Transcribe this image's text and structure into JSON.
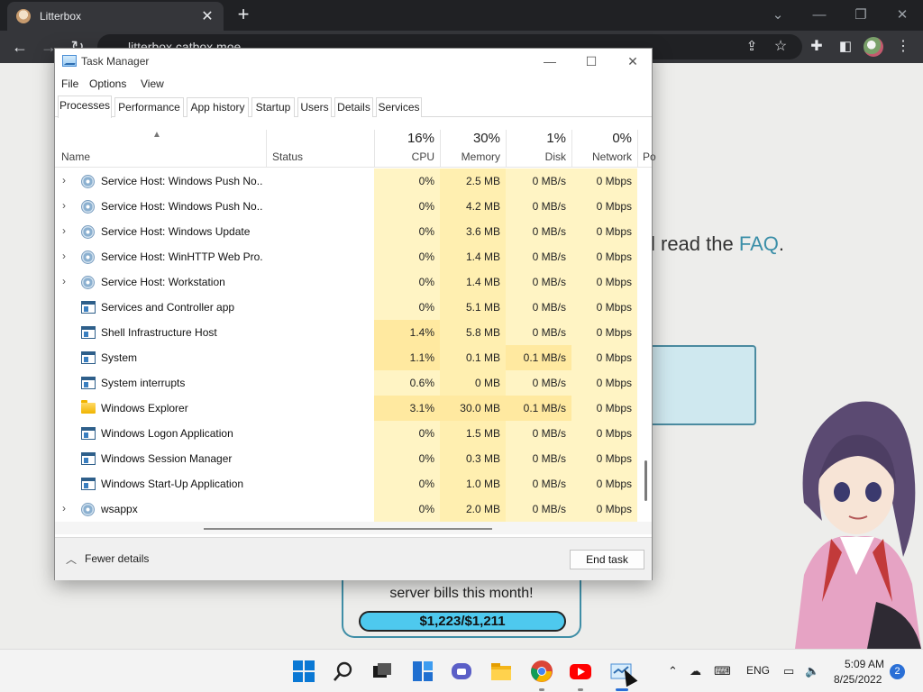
{
  "browser": {
    "tab_title": "Litterbox",
    "tab_close": "✕",
    "new_tab": "+",
    "url": "litterbox.catbox.moe",
    "window_controls": {
      "minimize": "—",
      "restore": "❐",
      "close": "✕",
      "tab_search": "⌄"
    },
    "toolbar_icons": [
      "arrow-left-icon",
      "arrow-right-icon",
      "reload-icon",
      "share-icon",
      "star-icon",
      "extensions-icon",
      "side-panel-icon",
      "profile-avatar",
      "kebab-menu-icon"
    ]
  },
  "page": {
    "faq_prefix": "l read the ",
    "faq_link": "FAQ",
    "faq_suffix": ".",
    "donate_text": "server bills this month!",
    "donate_amount": "$1,223/$1,211"
  },
  "task_manager": {
    "title": "Task Manager",
    "controls": {
      "minimize": "—",
      "maximize": "☐",
      "close": "✕"
    },
    "menu": [
      "File",
      "Options",
      "View"
    ],
    "tabs": [
      "Processes",
      "Performance",
      "App history",
      "Startup",
      "Users",
      "Details",
      "Services"
    ],
    "active_tab": "Processes",
    "columns": {
      "name": "Name",
      "status": "Status",
      "cpu": {
        "pct": "16%",
        "label": "CPU"
      },
      "memory": {
        "pct": "30%",
        "label": "Memory"
      },
      "disk": {
        "pct": "1%",
        "label": "Disk"
      },
      "network": {
        "pct": "0%",
        "label": "Network"
      },
      "power": "Po"
    },
    "rows": [
      {
        "name": "Service Host: Windows Push No...",
        "icon": "gear-icon",
        "expandable": true,
        "cpu": "0%",
        "memory": "2.5 MB",
        "disk": "0 MB/s",
        "network": "0 Mbps"
      },
      {
        "name": "Service Host: Windows Push No...",
        "icon": "gear-icon",
        "expandable": true,
        "cpu": "0%",
        "memory": "4.2 MB",
        "disk": "0 MB/s",
        "network": "0 Mbps"
      },
      {
        "name": "Service Host: Windows Update",
        "icon": "gear-icon",
        "expandable": true,
        "cpu": "0%",
        "memory": "3.6 MB",
        "disk": "0 MB/s",
        "network": "0 Mbps"
      },
      {
        "name": "Service Host: WinHTTP Web Pro...",
        "icon": "gear-icon",
        "expandable": true,
        "cpu": "0%",
        "memory": "1.4 MB",
        "disk": "0 MB/s",
        "network": "0 Mbps"
      },
      {
        "name": "Service Host: Workstation",
        "icon": "gear-icon",
        "expandable": true,
        "cpu": "0%",
        "memory": "1.4 MB",
        "disk": "0 MB/s",
        "network": "0 Mbps"
      },
      {
        "name": "Services and Controller app",
        "icon": "window-icon",
        "expandable": false,
        "cpu": "0%",
        "memory": "5.1 MB",
        "disk": "0 MB/s",
        "network": "0 Mbps"
      },
      {
        "name": "Shell Infrastructure Host",
        "icon": "window-icon",
        "expandable": false,
        "cpu": "1.4%",
        "memory": "5.8 MB",
        "disk": "0 MB/s",
        "network": "0 Mbps"
      },
      {
        "name": "System",
        "icon": "window-icon",
        "expandable": false,
        "cpu": "1.1%",
        "memory": "0.1 MB",
        "disk": "0.1 MB/s",
        "network": "0 Mbps"
      },
      {
        "name": "System interrupts",
        "icon": "window-icon",
        "expandable": false,
        "cpu": "0.6%",
        "memory": "0 MB",
        "disk": "0 MB/s",
        "network": "0 Mbps"
      },
      {
        "name": "Windows Explorer",
        "icon": "folder-icon",
        "expandable": false,
        "cpu": "3.1%",
        "memory": "30.0 MB",
        "disk": "0.1 MB/s",
        "network": "0 Mbps"
      },
      {
        "name": "Windows Logon Application",
        "icon": "window-icon",
        "expandable": false,
        "cpu": "0%",
        "memory": "1.5 MB",
        "disk": "0 MB/s",
        "network": "0 Mbps"
      },
      {
        "name": "Windows Session Manager",
        "icon": "window-icon",
        "expandable": false,
        "cpu": "0%",
        "memory": "0.3 MB",
        "disk": "0 MB/s",
        "network": "0 Mbps"
      },
      {
        "name": "Windows Start-Up Application",
        "icon": "window-icon",
        "expandable": false,
        "cpu": "0%",
        "memory": "1.0 MB",
        "disk": "0 MB/s",
        "network": "0 Mbps"
      },
      {
        "name": "wsappx",
        "icon": "gear-icon",
        "expandable": true,
        "cpu": "0%",
        "memory": "2.0 MB",
        "disk": "0 MB/s",
        "network": "0 Mbps"
      }
    ],
    "fewer_details": "Fewer details",
    "end_task": "End task"
  },
  "taskbar": {
    "apps": [
      "start-icon",
      "search-icon",
      "task-view-icon",
      "widgets-icon",
      "teams-chat-icon",
      "file-explorer-icon",
      "chrome-icon",
      "youtube-icon",
      "task-manager-icon"
    ],
    "language": "ENG",
    "time": "5:09 AM",
    "date": "8/25/2022",
    "notifications": "2"
  },
  "colors": {
    "cpu_heat_low": "#fff4c4",
    "cpu_heat_mid": "#ffe9a0",
    "memory_heat": "#ffefb0",
    "faq_link": "#3b8fa8",
    "donate_bar": "#4ec9ee",
    "chrome_dark": "#202124"
  }
}
